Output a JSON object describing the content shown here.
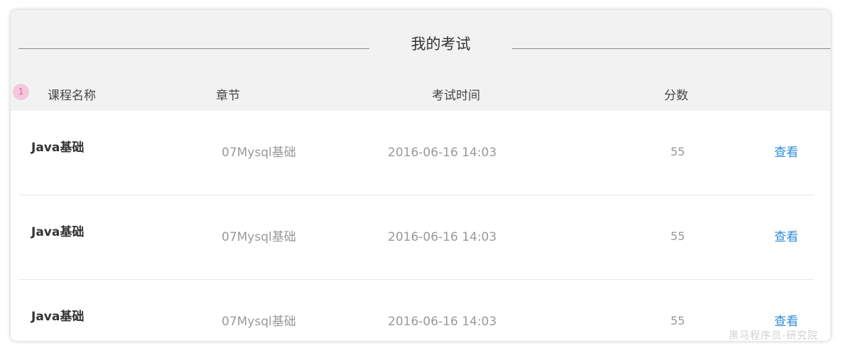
{
  "page": {
    "title": "我的考试"
  },
  "table": {
    "badge": "1",
    "headers": {
      "course": "课程名称",
      "chapter": "章节",
      "time": "考试时间",
      "score": "分数"
    },
    "rows": [
      {
        "course": "Java基础",
        "chapter": "07Mysql基础",
        "time": "2016-06-16  14:03",
        "score": "55",
        "action": "查看"
      },
      {
        "course": "Java基础",
        "chapter": "07Mysql基础",
        "time": "2016-06-16  14:03",
        "score": "55",
        "action": "查看"
      },
      {
        "course": "Java基础",
        "chapter": "07Mysql基础",
        "time": "2016-06-16  14:03",
        "score": "55",
        "action": "查看"
      }
    ]
  },
  "watermark": "黑马程序员-研究院",
  "colors": {
    "header_bg": "#f2f2f2",
    "link": "#2d8cdb",
    "badge_bg": "#f5c6dc",
    "badge_text": "#e0609a"
  }
}
